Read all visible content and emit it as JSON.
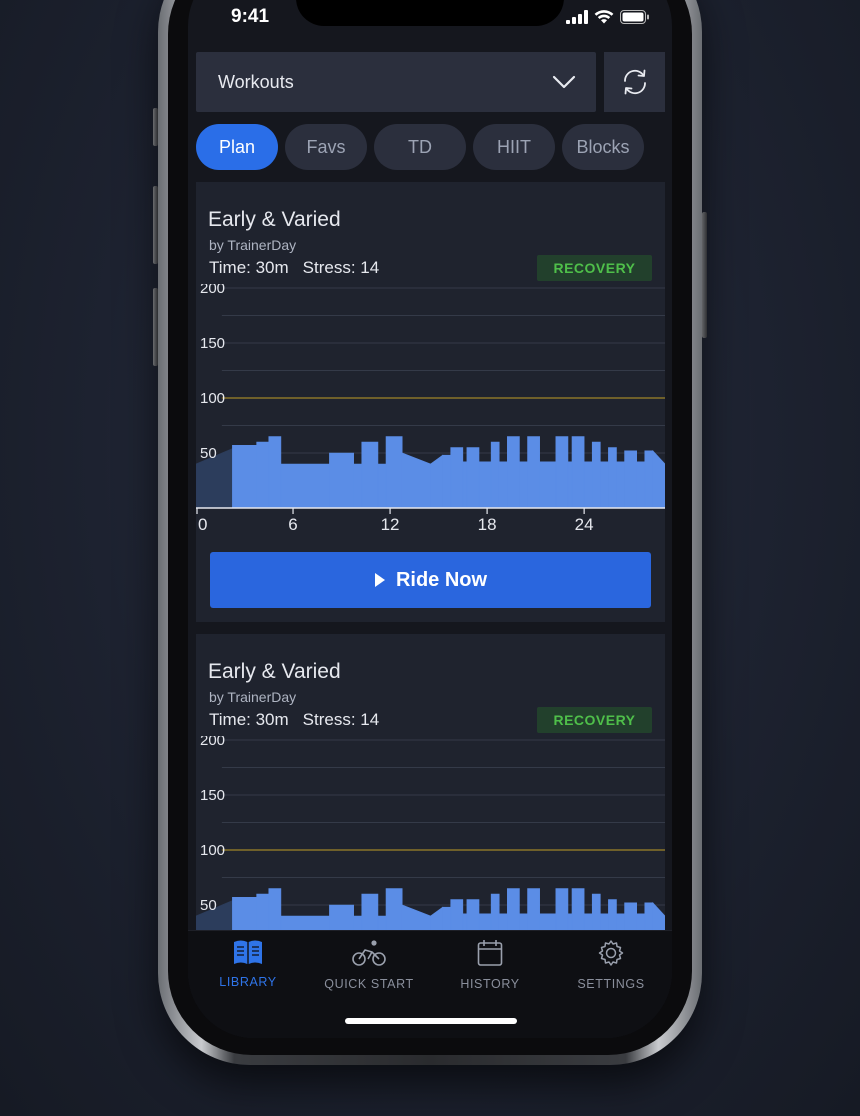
{
  "status": {
    "time": "9:41"
  },
  "header": {
    "dropdown_label": "Workouts"
  },
  "tabs": [
    {
      "label": "Plan",
      "active": true
    },
    {
      "label": "Favs",
      "active": false
    },
    {
      "label": "TD",
      "active": false
    },
    {
      "label": "HIIT",
      "active": false
    },
    {
      "label": "Blocks",
      "active": false
    }
  ],
  "cards": [
    {
      "title": "Early & Varied",
      "author": "by TrainerDay",
      "time": "Time: 30m",
      "stress": "Stress: 14",
      "badge": "RECOVERY",
      "ride_label": "Ride Now"
    },
    {
      "title": "Early & Varied",
      "author": "by TrainerDay",
      "time": "Time: 30m",
      "stress": "Stress: 14",
      "badge": "RECOVERY"
    }
  ],
  "chart_data": {
    "type": "area",
    "title": "",
    "xlabel": "",
    "ylabel": "",
    "ylim": [
      0,
      200
    ],
    "xlim": [
      0,
      29
    ],
    "y_ticks": [
      200,
      150,
      100,
      50
    ],
    "x_ticks": [
      0,
      6,
      12,
      18,
      24
    ],
    "reference_line": 100,
    "completed_until": 2.25,
    "segments": [
      {
        "start": 0,
        "end": 2.25,
        "from": 40,
        "to": 54
      },
      {
        "start": 2.25,
        "end": 3.75,
        "from": 57,
        "to": 57
      },
      {
        "start": 3.75,
        "end": 4.5,
        "from": 60,
        "to": 60
      },
      {
        "start": 4.5,
        "end": 5.25,
        "from": 65,
        "to": 65
      },
      {
        "start": 5.25,
        "end": 8.25,
        "from": 40,
        "to": 40
      },
      {
        "start": 8.25,
        "end": 9.75,
        "from": 50,
        "to": 50
      },
      {
        "start": 9.75,
        "end": 10.25,
        "from": 40,
        "to": 40
      },
      {
        "start": 10.25,
        "end": 11.25,
        "from": 60,
        "to": 60
      },
      {
        "start": 11.25,
        "end": 11.75,
        "from": 40,
        "to": 40
      },
      {
        "start": 11.75,
        "end": 12.75,
        "from": 65,
        "to": 65
      },
      {
        "start": 12.75,
        "end": 14.5,
        "from": 50,
        "to": 40
      },
      {
        "start": 14.5,
        "end": 15.25,
        "from": 40,
        "to": 48
      },
      {
        "start": 15.25,
        "end": 15.75,
        "from": 48,
        "to": 48
      },
      {
        "start": 15.75,
        "end": 16.5,
        "from": 55,
        "to": 55
      },
      {
        "start": 16.5,
        "end": 16.75,
        "from": 42,
        "to": 42
      },
      {
        "start": 16.75,
        "end": 17.5,
        "from": 55,
        "to": 55
      },
      {
        "start": 17.5,
        "end": 18.25,
        "from": 42,
        "to": 42
      },
      {
        "start": 18.25,
        "end": 18.75,
        "from": 60,
        "to": 60
      },
      {
        "start": 18.75,
        "end": 19.25,
        "from": 42,
        "to": 42
      },
      {
        "start": 19.25,
        "end": 20.0,
        "from": 65,
        "to": 65
      },
      {
        "start": 20.0,
        "end": 20.5,
        "from": 42,
        "to": 42
      },
      {
        "start": 20.5,
        "end": 21.25,
        "from": 65,
        "to": 65
      },
      {
        "start": 21.25,
        "end": 22.25,
        "from": 42,
        "to": 42
      },
      {
        "start": 22.25,
        "end": 23.0,
        "from": 65,
        "to": 65
      },
      {
        "start": 23.0,
        "end": 23.25,
        "from": 42,
        "to": 42
      },
      {
        "start": 23.25,
        "end": 24.0,
        "from": 65,
        "to": 65
      },
      {
        "start": 24.0,
        "end": 24.5,
        "from": 42,
        "to": 42
      },
      {
        "start": 24.5,
        "end": 25.0,
        "from": 60,
        "to": 60
      },
      {
        "start": 25.0,
        "end": 25.5,
        "from": 42,
        "to": 42
      },
      {
        "start": 25.5,
        "end": 26.0,
        "from": 55,
        "to": 55
      },
      {
        "start": 26.0,
        "end": 26.5,
        "from": 42,
        "to": 42
      },
      {
        "start": 26.5,
        "end": 27.25,
        "from": 52,
        "to": 52
      },
      {
        "start": 27.25,
        "end": 27.75,
        "from": 42,
        "to": 42
      },
      {
        "start": 27.75,
        "end": 28.25,
        "from": 52,
        "to": 52
      },
      {
        "start": 28.25,
        "end": 29.0,
        "from": 52,
        "to": 40
      }
    ]
  },
  "bottom_nav": [
    {
      "label": "LIBRARY",
      "icon": "book-icon",
      "active": true
    },
    {
      "label": "QUICK START",
      "icon": "cyclist-icon",
      "active": false
    },
    {
      "label": "HISTORY",
      "icon": "calendar-icon",
      "active": false
    },
    {
      "label": "SETTINGS",
      "icon": "gear-icon",
      "active": false
    }
  ],
  "colors": {
    "accent": "#2a6ee8",
    "chart_fill": "#5b8de6",
    "chart_completed": "#2c3d5c",
    "reference_line": "#8a7428",
    "badge_text": "#4fbf4a",
    "badge_bg": "#22402c"
  }
}
